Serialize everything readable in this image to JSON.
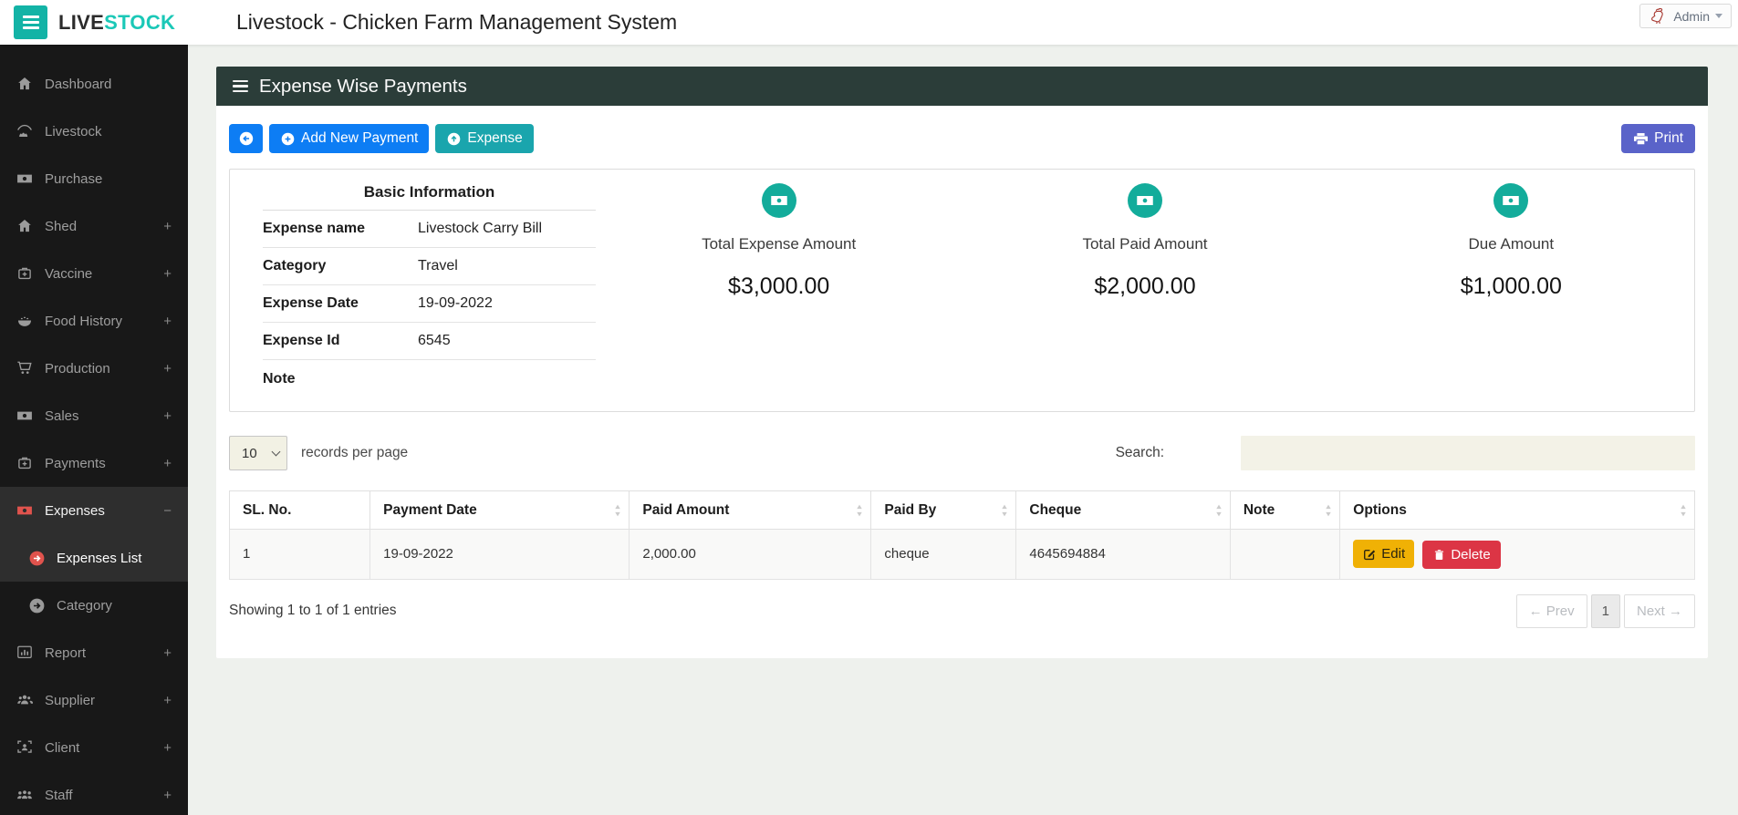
{
  "topbar": {
    "brand_live": "LIVE",
    "brand_stock": "STOCK",
    "title": "Livestock - Chicken Farm Management System",
    "admin_label": "Admin"
  },
  "sidebar": {
    "items": [
      {
        "label": "Dashboard",
        "suffix": ""
      },
      {
        "label": "Livestock",
        "suffix": ""
      },
      {
        "label": "Purchase",
        "suffix": ""
      },
      {
        "label": "Shed",
        "suffix": "+"
      },
      {
        "label": "Vaccine",
        "suffix": "+"
      },
      {
        "label": "Food History",
        "suffix": "+"
      },
      {
        "label": "Production",
        "suffix": "+"
      },
      {
        "label": "Sales",
        "suffix": "+"
      },
      {
        "label": "Payments",
        "suffix": "+"
      },
      {
        "label": "Expenses",
        "suffix": "−"
      },
      {
        "label": "Report",
        "suffix": "+"
      },
      {
        "label": "Supplier",
        "suffix": "+"
      },
      {
        "label": "Client",
        "suffix": "+"
      },
      {
        "label": "Staff",
        "suffix": "+"
      }
    ],
    "submenu": [
      {
        "label": "Expenses List"
      },
      {
        "label": "Category"
      }
    ]
  },
  "panel": {
    "title": "Expense Wise Payments",
    "toolbar": {
      "add_new_payment": "Add New Payment",
      "expense": "Expense",
      "print": "Print"
    },
    "basic_info": {
      "title": "Basic Information",
      "rows": [
        {
          "label": "Expense name",
          "value": "Livestock Carry Bill"
        },
        {
          "label": "Category",
          "value": "Travel"
        },
        {
          "label": "Expense Date",
          "value": "19-09-2022"
        },
        {
          "label": "Expense Id",
          "value": "6545"
        },
        {
          "label": "Note",
          "value": ""
        }
      ]
    },
    "summary_cards": [
      {
        "label": "Total Expense Amount",
        "amount": "$3,000.00"
      },
      {
        "label": "Total Paid Amount",
        "amount": "$2,000.00"
      },
      {
        "label": "Due Amount",
        "amount": "$1,000.00"
      }
    ],
    "table_controls": {
      "records_per_page_value": "10",
      "records_per_page_label": "records per page",
      "search_label": "Search:",
      "search_value": ""
    },
    "table": {
      "headers": [
        "SL. No.",
        "Payment Date",
        "Paid Amount",
        "Paid By",
        "Cheque",
        "Note",
        "Options"
      ],
      "row": {
        "sl": "1",
        "payment_date": "19-09-2022",
        "paid_amount": "2,000.00",
        "paid_by": "cheque",
        "cheque": "4645694884",
        "note": "",
        "edit_label": "Edit",
        "delete_label": "Delete"
      }
    },
    "footer": {
      "showing": "Showing 1 to 1 of 1 entries",
      "prev": "← Prev",
      "page": "1",
      "next": "Next →"
    }
  },
  "colors": {
    "brand_teal": "#13b3a6",
    "primary_blue": "#0d7df4",
    "teal_button": "#1aa5ad",
    "print_indigo": "#5a63c9",
    "edit_yellow": "#f0b105",
    "delete_red": "#dc3545",
    "panel_header": "#2b3d39",
    "sidebar_active_red": "#e0534d",
    "card_icon_teal": "#13ac9b"
  }
}
